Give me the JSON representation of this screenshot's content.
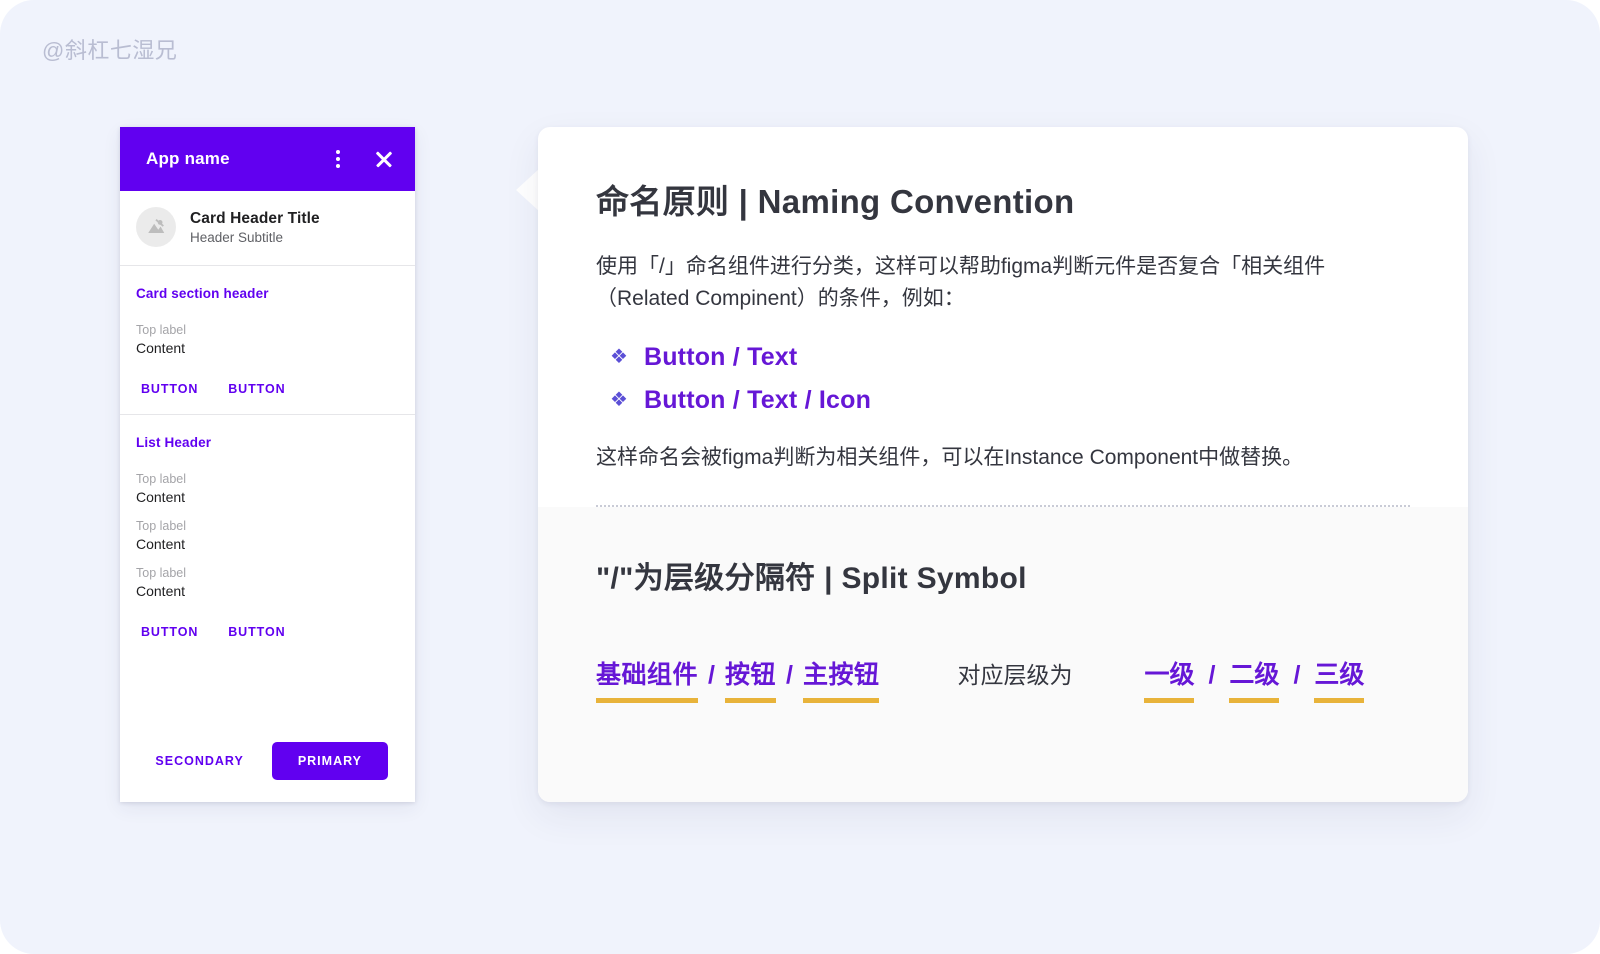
{
  "watermark": "@斜杠七湿兄",
  "colors": {
    "page_background": "#F0F3FC",
    "primary_purple": "#6100F0",
    "accent_purple": "#6617D6",
    "underline_gold": "#E8B33A",
    "text_dark": "#34363F"
  },
  "card": {
    "appbar": {
      "title": "App name",
      "overflow_icon": "more-vertical-icon",
      "close_icon": "close-icon"
    },
    "header": {
      "avatar_icon": "image-placeholder-icon",
      "title": "Card Header Title",
      "subtitle": "Header Subtitle"
    },
    "section_one": {
      "header": "Card section header",
      "fields": [
        {
          "label": "Top label",
          "value": "Content"
        }
      ],
      "buttons": [
        "BUTTON",
        "BUTTON"
      ]
    },
    "section_two": {
      "header": "List Header",
      "fields": [
        {
          "label": "Top label",
          "value": "Content"
        },
        {
          "label": "Top label",
          "value": "Content"
        },
        {
          "label": "Top label",
          "value": "Content"
        }
      ],
      "buttons": [
        "BUTTON",
        "BUTTON"
      ]
    },
    "footer": {
      "secondary": "SECONDARY",
      "primary": "PRIMARY"
    }
  },
  "panel": {
    "naming": {
      "title": "命名原则 | Naming Convention",
      "paragraph": "使用「/」命名组件进行分类，这样可以帮助figma判断元件是否复合「相关组件（Related Compinent）的条件，例如：",
      "bullet_glyph": "❖",
      "examples": [
        "Button / Text",
        "Button / Text / Icon"
      ],
      "closing": "这样命名会被figma判断为相关组件，可以在Instance Component中做替换。"
    },
    "split": {
      "title": "\"/\"为层级分隔符 | Split Symbol",
      "component_path": [
        "基础组件",
        "按钮",
        "主按钮"
      ],
      "connector": "对应层级为",
      "levels": [
        "一级",
        "二级",
        "三级"
      ],
      "separator": "/"
    }
  }
}
